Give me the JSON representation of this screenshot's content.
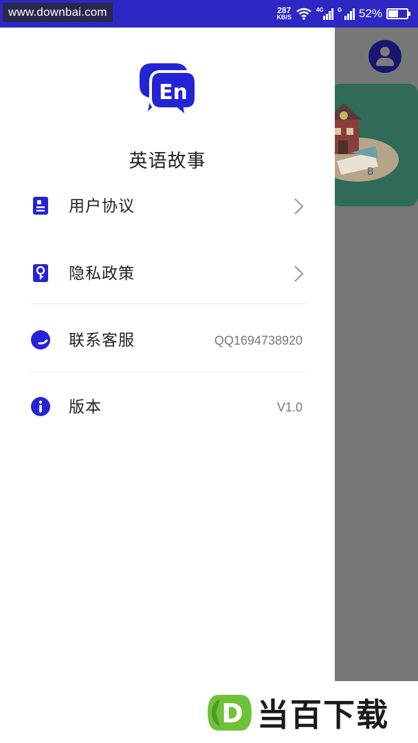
{
  "status_bar": {
    "watermark": "www.downbai.com",
    "net_speed_value": "287",
    "net_speed_unit": "KB/S",
    "signal_1_label": "4G",
    "signal_2_label": "G",
    "battery_text": "52%",
    "battery_level": 0.52,
    "background_color": "#2d28c4"
  },
  "drawer": {
    "app_name": "英语故事",
    "logo_text": "En",
    "accent_color": "#2424d6",
    "items": [
      {
        "label": "用户协议",
        "icon": "document-icon",
        "value": "",
        "chevron": true
      },
      {
        "label": "隐私政策",
        "icon": "key-lock-icon",
        "value": "",
        "chevron": true
      },
      {
        "label": "联系客服",
        "icon": "customer-service-icon",
        "value": "QQ1694738920",
        "chevron": false
      },
      {
        "label": "版本",
        "icon": "info-icon",
        "value": "V1.0",
        "chevron": false
      }
    ]
  },
  "background": {
    "avatar_icon": "user-avatar-icon",
    "banner_color": "#2f6b58"
  },
  "brand_watermark": {
    "mark_letter": "D",
    "text": "当百下载",
    "mark_color": "#6fc13a"
  }
}
